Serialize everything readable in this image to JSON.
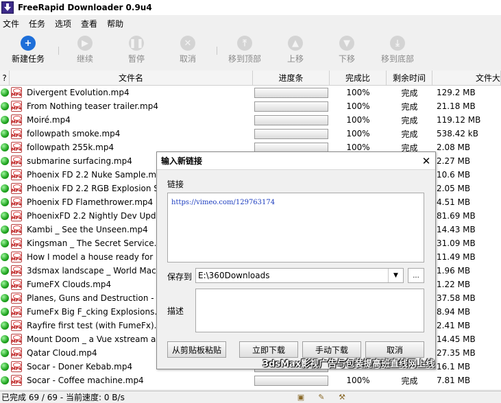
{
  "window": {
    "title": "FreeRapid Downloader 0.9u4"
  },
  "menu": [
    "文件",
    "任务",
    "选项",
    "查看",
    "帮助"
  ],
  "toolbar": {
    "new_task": "新建任务",
    "resume": "继续",
    "pause": "暂停",
    "cancel": "取消",
    "move_top": "移到顶部",
    "move_up": "上移",
    "move_down": "下移",
    "move_bottom": "移到底部"
  },
  "table": {
    "headers": {
      "q": "?",
      "name": "文件名",
      "progress": "进度条",
      "completed": "完成比",
      "remaining": "剩余时间",
      "size": "文件大"
    },
    "rows": [
      {
        "name": "Divergent Evolution.mp4",
        "progress": 1.0,
        "completed": "100%",
        "remaining": "完成",
        "size": "129.2 MB"
      },
      {
        "name": "From Nothing teaser trailer.mp4",
        "progress": 1.0,
        "completed": "100%",
        "remaining": "完成",
        "size": "21.18 MB"
      },
      {
        "name": "Moiré.mp4",
        "progress": 1.0,
        "completed": "100%",
        "remaining": "完成",
        "size": "119.12 MB"
      },
      {
        "name": "followpath smoke.mp4",
        "progress": 1.0,
        "completed": "100%",
        "remaining": "完成",
        "size": "538.42 kB"
      },
      {
        "name": "followpath 255k.mp4",
        "progress": 1.0,
        "completed": "100%",
        "remaining": "完成",
        "size": "2.08 MB"
      },
      {
        "name": "submarine surfacing.mp4",
        "progress": 1.0,
        "completed": "",
        "remaining": "",
        "size": "2.27 MB"
      },
      {
        "name": "Phoenix FD 2.2 Nuke Sample.mp4",
        "progress": 1.0,
        "completed": "",
        "remaining": "",
        "size": "10.6 MB"
      },
      {
        "name": "Phoenix FD 2.2 RGB Explosion Sa",
        "progress": 1.0,
        "completed": "",
        "remaining": "",
        "size": "2.05 MB"
      },
      {
        "name": "Phoenix FD Flamethrower.mp4",
        "progress": 1.0,
        "completed": "",
        "remaining": "",
        "size": "4.51 MB"
      },
      {
        "name": "PhoenixFD 2.2 Nightly Dev Update",
        "progress": 1.0,
        "completed": "",
        "remaining": "",
        "size": "81.69 MB"
      },
      {
        "name": "Kambi _ See the Unseen.mp4",
        "progress": 1.0,
        "completed": "",
        "remaining": "",
        "size": "14.43 MB"
      },
      {
        "name": "Kingsman _ The Secret Service.m",
        "progress": 1.0,
        "completed": "",
        "remaining": "",
        "size": "31.09 MB"
      },
      {
        "name": "How I model a house ready for blo",
        "progress": 1.0,
        "completed": "",
        "remaining": "",
        "size": "11.49 MB"
      },
      {
        "name": "3dsmax landscape _ World Machi",
        "progress": 1.0,
        "completed": "",
        "remaining": "",
        "size": "1.96 MB"
      },
      {
        "name": "FumeFX Clouds.mp4",
        "progress": 1.0,
        "completed": "",
        "remaining": "",
        "size": "1.22 MB"
      },
      {
        "name": "Planes, Guns and Destruction - Sh",
        "progress": 1.0,
        "completed": "",
        "remaining": "",
        "size": "37.58 MB"
      },
      {
        "name": "FumeFx Big F_cking Explosions.m",
        "progress": 1.0,
        "completed": "",
        "remaining": "",
        "size": "8.94 MB"
      },
      {
        "name": "Rayfire first test (with FumeFx).mp",
        "progress": 1.0,
        "completed": "",
        "remaining": "",
        "size": "2.41 MB"
      },
      {
        "name": "Mount Doom _ a Vue xstream anin",
        "progress": 1.0,
        "completed": "",
        "remaining": "",
        "size": "14.45 MB"
      },
      {
        "name": "Qatar Cloud.mp4",
        "progress": 1.0,
        "completed": "",
        "remaining": "",
        "size": "27.35 MB"
      },
      {
        "name": "Socar - Doner Kebab.mp4",
        "progress": 1.0,
        "completed": "",
        "remaining": "",
        "size": "16.1 MB"
      },
      {
        "name": "Socar - Coffee machine.mp4",
        "progress": 1.0,
        "completed": "100%",
        "remaining": "完成",
        "size": "7.81 MB"
      }
    ]
  },
  "status": {
    "text": "已完成 69 / 69 - 当前速度: 0 B/s"
  },
  "dialog": {
    "title": "输入新链接",
    "close": "✕",
    "link_label": "链接",
    "url": "https://vimeo.com/129763174",
    "save_label": "保存到",
    "save_path": "E:\\360Downloads",
    "browse": "...",
    "desc_label": "描述",
    "paste": "从剪贴板粘贴",
    "download_now": "立即下载",
    "manual": "手动下载",
    "cancel": "取消"
  },
  "watermark": "3dsMax影视广告与包装提高班直线网上线",
  "colors": {
    "accent": "#1e6fd9",
    "status_ok": "#1ea31e",
    "link": "#1a3bbf"
  }
}
